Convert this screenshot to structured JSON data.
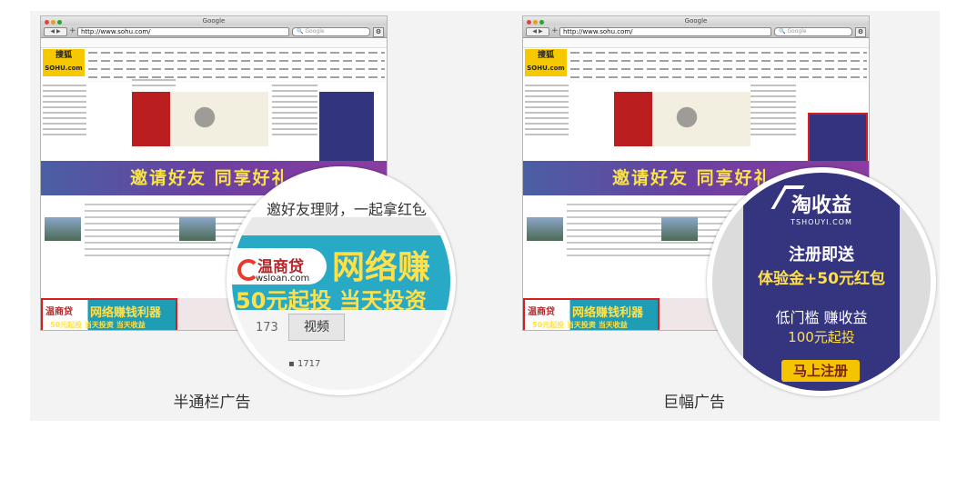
{
  "panels": [
    {
      "caption": "半通栏广告",
      "browser": {
        "title": "Google",
        "url": "http://www.sohu.com/",
        "search_placeholder": "Google",
        "site_logo": "搜狐",
        "site_logo_sub": "SOHU.com",
        "wide_banner_text": "邀请好友 同享好礼",
        "half_banner_logo": "温商贷",
        "half_banner_text": "网络赚钱利器",
        "half_banner_sub": "50元起投 当天投资 当天收益"
      },
      "zoom": {
        "top_text": "邀好友理财，一起拿红包",
        "logo_main": "温商贷",
        "logo_url": "wsloan.com",
        "big_text": "网络赚",
        "small_text": "50元起投 当天投资",
        "count_text": "173",
        "tab_text": "视频",
        "tab_sub": "▪ 1717"
      }
    },
    {
      "caption": "巨幅广告",
      "browser": {
        "title": "Google",
        "url": "http://www.sohu.com/",
        "search_placeholder": "Google",
        "site_logo": "搜狐",
        "site_logo_sub": "SOHU.com",
        "wide_banner_text": "邀请好友 同享好礼",
        "half_banner_logo": "温商贷",
        "half_banner_text": "网络赚钱利器",
        "half_banner_sub": "50元起投 当天投资 当天收益"
      },
      "zoom": {
        "logo_main": "淘收益",
        "logo_url": "TSHOUYI.COM",
        "line1": "注册即送",
        "line2": "体验金+50元红包",
        "line3": "低门槛 赚收益",
        "line4": "100元起投",
        "button": "马上注册"
      }
    }
  ],
  "colors": {
    "panel_bg": "#f3f3f3",
    "highlight_border": "#d71d1d",
    "half_banner_bg": "#28a9c5",
    "giant_ad_bg": "#34347f",
    "accent_yellow": "#ffe04a"
  }
}
